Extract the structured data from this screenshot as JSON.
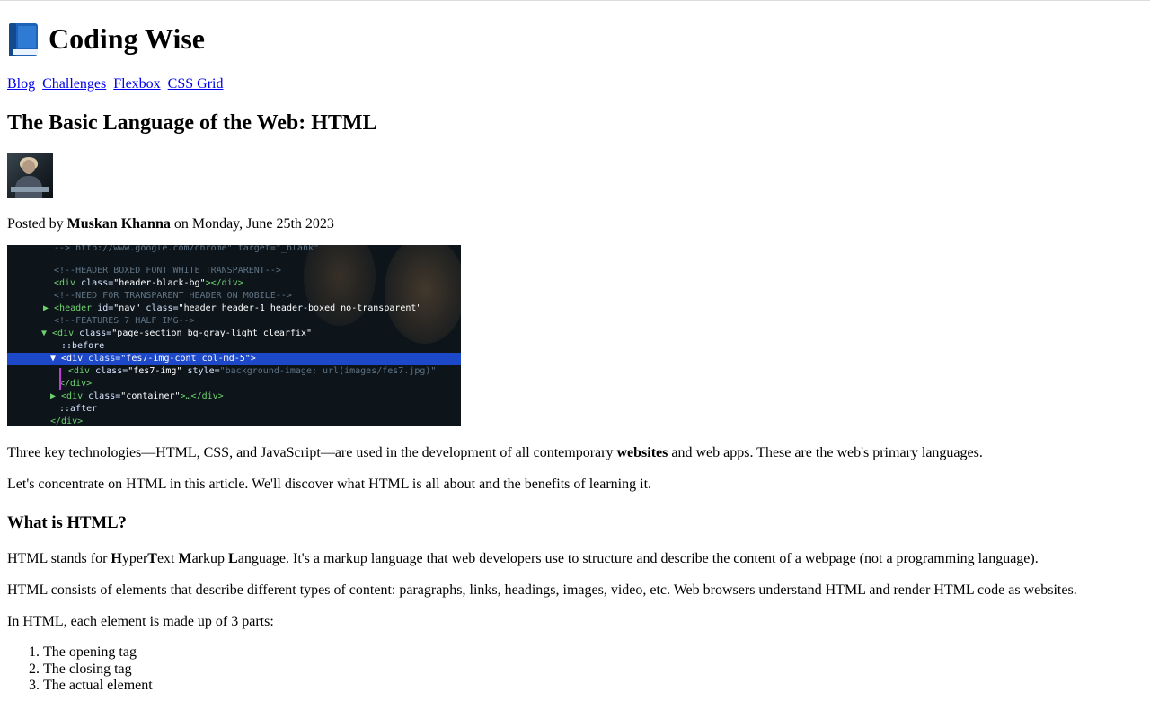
{
  "site": {
    "title": "Coding Wise",
    "icon": "blue-book-icon"
  },
  "nav": {
    "items": [
      "Blog",
      "Challenges",
      "Flexbox",
      "CSS Grid"
    ]
  },
  "article": {
    "title": "The Basic Language of the Web: HTML",
    "posted_prefix": "Posted by",
    "author": "Muskan Khanna",
    "posted_suffix": "on Monday, June 25th 2023",
    "para1_a": "Three key technologies—HTML, CSS, and JavaScript—are used in the development of all contemporary",
    "para1_bold": "websites",
    "para1_b": "and web apps. These are the web's primary languages.",
    "para2": "Let's concentrate on HTML in this article. We'll discover what HTML is all about and the benefits of learning it.",
    "heading1": "What is HTML?",
    "para3_a": "HTML stands for",
    "para3_h": "H",
    "para3_yper": "yper",
    "para3_t": "T",
    "para3_ext": "ext",
    "para3_m": "M",
    "para3_arkup": "arkup",
    "para3_l": "L",
    "para3_rest": "anguage. It's a markup language that web developers use to structure and describe the content of a webpage (not a programming language).",
    "para4": "HTML consists of elements that describe different types of content: paragraphs, links, headings, images, video, etc. Web browsers understand HTML and render HTML code as websites.",
    "para5": "In HTML, each element is made up of 3 parts:",
    "list": [
      "The opening tag",
      "The closing tag",
      "The actual element"
    ]
  },
  "hero_code": {
    "line0": "-->  http://www.google.com/chrome\" target=\"_blank\"",
    "line1": "<!--HEADER BOXED FONT WHITE TRANSPARENT-->",
    "line2_tag": "<div",
    "line2_attr": " class=",
    "line2_val": "\"header-black-bg\"",
    "line2_end": "></div>",
    "line3": "<!--NEED FOR TRANSPARENT HEADER ON MOBILE-->",
    "line4_tag": "▶ <header",
    "line4_attr": " id=",
    "line4_val": "\"nav\"",
    "line4_attr2": " class=",
    "line4_val2": "\"header header-1 header-boxed no-transparent\"",
    "line5": "<!--FEATURES 7 HALF IMG-->",
    "line6_tag": "▼ <div",
    "line6_attr": " class=",
    "line6_val": "\"page-section bg-gray-light clearfix\"",
    "line7": "::before",
    "line8_tag": "▼ <div",
    "line8_attr": " class=",
    "line8_val": "\"fes7-img-cont col-md-5\"",
    "line8_end": ">",
    "line9_tag": "<div",
    "line9_attr": " class=",
    "line9_val": "\"fes7-img\"",
    "line9_attr2": " style=",
    "line9_val2": "\"background-image: url(images/fes7.jpg)\"",
    "line10": "</div>",
    "line11_tag": "▶ <div",
    "line11_attr": " class=",
    "line11_val": "\"container\"",
    "line11_end": ">…</div>",
    "line12": "::after",
    "line13": "</div>"
  }
}
